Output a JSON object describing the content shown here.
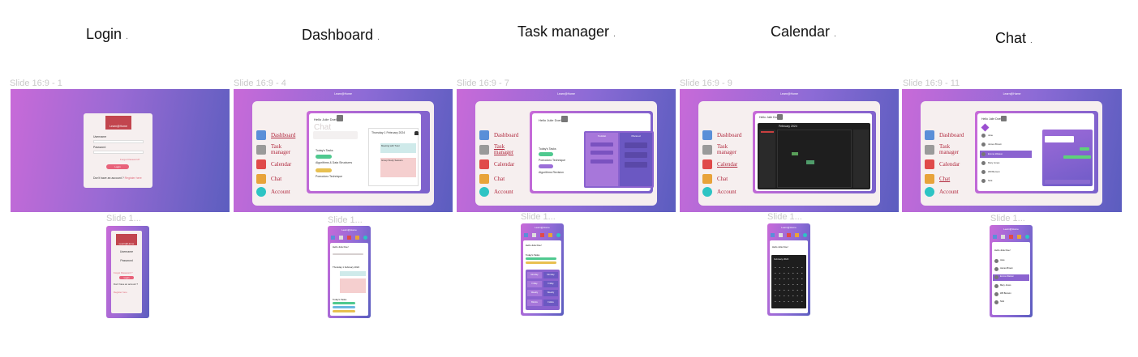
{
  "columns": [
    {
      "heading": "Login",
      "dot": ".",
      "slide_label": "Slide 16:9 - 1",
      "mobile_label": "Slide 1..."
    },
    {
      "heading": "Dashboard",
      "dot": ".",
      "slide_label": "Slide 16:9 - 4",
      "mobile_label": "Slide 1..."
    },
    {
      "heading": "Task manager",
      "dot": ".",
      "slide_label": "Slide 16:9 - 7",
      "mobile_label": "Slide 1..."
    },
    {
      "heading": "Calendar",
      "dot": ".",
      "slide_label": "Slide 16:9 - 9",
      "mobile_label": "Slide 1..."
    },
    {
      "heading": "Chat",
      "dot": ".",
      "slide_label": "Slide 16:9 - 11",
      "mobile_label": "Slide 1..."
    }
  ],
  "login": {
    "logo": "Learn@Home",
    "username_label": "Username",
    "password_label": "Password",
    "forgot": "Forgot Password?",
    "login_button": "Login",
    "no_account": "Don't have an account ?",
    "register": "Register here",
    "mobile_username": "Username",
    "mobile_password": "Password",
    "mobile_forgot": "Forgot Password ?",
    "mobile_no_account": "Don't have an account ?",
    "mobile_register": "Register here"
  },
  "app_title": "Learn@Home",
  "nav": [
    {
      "label": "Dashboard",
      "icon": "monitor-icon",
      "color": "#5a8fd8"
    },
    {
      "label": "Task manager",
      "icon": "checklist-icon",
      "color": "#8a8a8a"
    },
    {
      "label": "Calendar",
      "icon": "calendar-icon",
      "color": "#e04a4a"
    },
    {
      "label": "Chat",
      "icon": "chat-icon",
      "color": "#e8a33a"
    },
    {
      "label": "Account",
      "icon": "account-icon",
      "color": "#2ec4c4"
    }
  ],
  "dashboard": {
    "greeting": "Hello Julie Doe!",
    "chat_overlay": "Chat",
    "today_tasks": "Today's Tasks",
    "date_title": "Thursday 1 February 2024",
    "task1": "Algorithms & Data Structures",
    "task2": "Pomodoro Technique",
    "event1": "Meeting with Tutor",
    "event2": "Group Study Session"
  },
  "taskmanager": {
    "greeting": "Hello Julie Doe!",
    "today_tasks": "Today's Tasks",
    "col_left": "Todolist",
    "col_right": "Planned",
    "task1": "Pomodoro Technique",
    "task2": "Algorithms Revision",
    "mobile_items": [
      "Monday",
      "Monday",
      "Friday",
      "Friday",
      "Weekly",
      "Weekly",
      "Blocks",
      "Follow"
    ]
  },
  "calendar": {
    "greeting": "Hello Julie Doe!",
    "month": "February 2024",
    "mobile_month": "February 2024",
    "weekdays": [
      "Sun",
      "Mon",
      "Tue",
      "Wed",
      "Thu",
      "Fri",
      "Sat"
    ]
  },
  "chat": {
    "greeting": "Hello Julie Doe!",
    "contacts": [
      "Jane",
      "James Brown",
      "Emma Watson",
      "Mary Jones",
      "Will Benson",
      "Nick"
    ],
    "mobile_greeting": "Hello Julie Doe!"
  },
  "colors": {
    "accent": "#b0283d",
    "login_button": "#e8627a",
    "gradient_start": "#c86ad8",
    "gradient_end": "#5b5dbf"
  }
}
